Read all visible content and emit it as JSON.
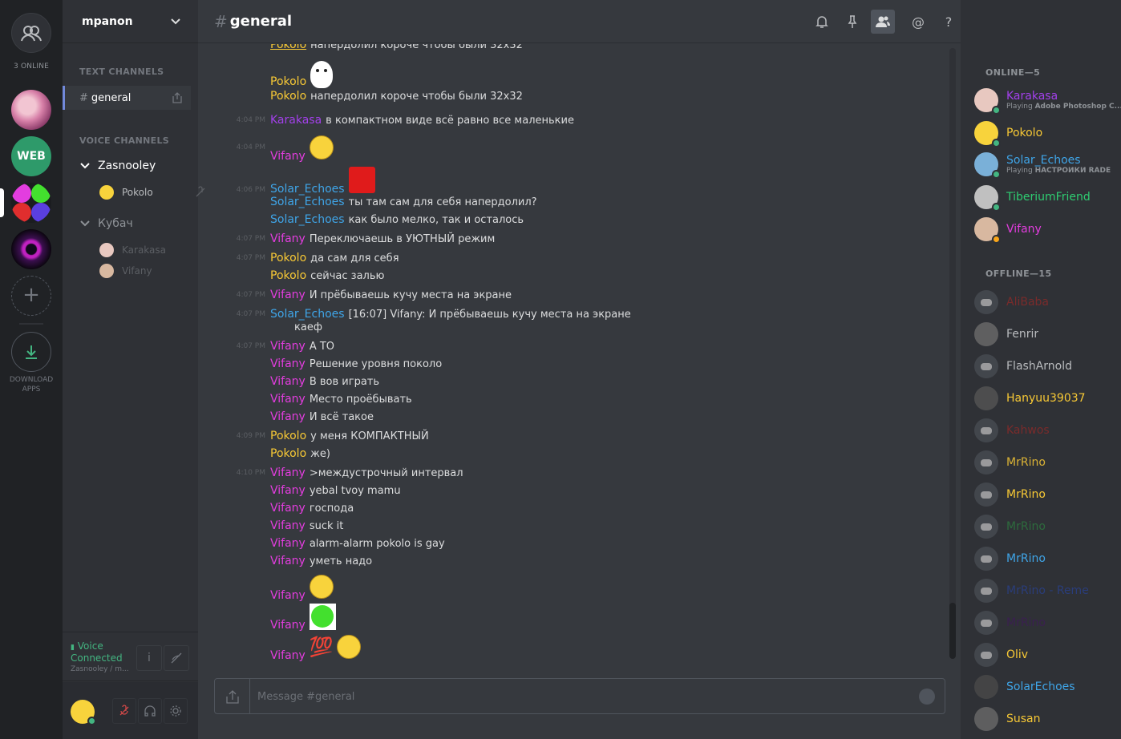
{
  "rail": {
    "online_count": "3 ONLINE",
    "web_server_label": "WEB",
    "add_server": "+",
    "download_label_1": "DOWNLOAD",
    "download_label_2": "APPS"
  },
  "guild": {
    "name": "mpanon",
    "text_category": "TEXT CHANNELS",
    "voice_category": "VOICE CHANNELS",
    "channel": "general",
    "voice_channels": [
      {
        "name": "Zasnooley",
        "users": [
          "Pokolo"
        ]
      },
      {
        "name": "Кубач",
        "users": [
          "Karakasa",
          "Vifany"
        ]
      }
    ]
  },
  "voice": {
    "status_1": "Voice",
    "status_2": "Connected",
    "sub": "Zasnooley / m..."
  },
  "header": {
    "hash": "#",
    "title": "general"
  },
  "messages": [
    {
      "time": "",
      "author": "Pokolo",
      "text": "напердолил короче чтобы были 32x32",
      "cut": true
    },
    {
      "time": "",
      "author": "Pokolo",
      "text": ""
    },
    {
      "time": "",
      "author": "Pokolo",
      "text": "напердолил короче чтобы были 32x32"
    },
    {
      "time": "4:04 PM",
      "author": "Karakasa",
      "text": "в компактном виде всё равно все маленькие"
    },
    {
      "time": "4:04 PM",
      "author": "Vifany",
      "text": ""
    },
    {
      "time": "4:06 PM",
      "author": "Solar_Echoes",
      "text": ""
    },
    {
      "time": "",
      "author": "Solar_Echoes",
      "text": "ты там сам для себя напердолил?"
    },
    {
      "time": "",
      "author": "Solar_Echoes",
      "text": "как было мелко, так и осталось"
    },
    {
      "time": "4:07 PM",
      "author": "Vifany",
      "text": "Переключаешь в УЮТНЫЙ режим"
    },
    {
      "time": "4:07 PM",
      "author": "Pokolo",
      "text": "да сам для себя"
    },
    {
      "time": "",
      "author": "Pokolo",
      "text": "сейчас залью"
    },
    {
      "time": "4:07 PM",
      "author": "Vifany",
      "text": "И прёбываешь кучу места на экране"
    },
    {
      "time": "4:07 PM",
      "author": "Solar_Echoes",
      "text": "[16:07] Vifany: И прёбываешь кучу места на экране",
      "text2": "каеф"
    },
    {
      "time": "4:07 PM",
      "author": "Vifany",
      "text": "А ТО"
    },
    {
      "time": "",
      "author": "Vifany",
      "text": "Решение уровня поколо"
    },
    {
      "time": "",
      "author": "Vifany",
      "text": "В вов играть"
    },
    {
      "time": "",
      "author": "Vifany",
      "text": "Место проёбывать"
    },
    {
      "time": "",
      "author": "Vifany",
      "text": "И всё такое"
    },
    {
      "time": "4:09 PM",
      "author": "Pokolo",
      "text": "у меня КОМПАКТНЫЙ"
    },
    {
      "time": "",
      "author": "Pokolo",
      "text": "же)"
    },
    {
      "time": "4:10 PM",
      "author": "Vifany",
      "text": ">междустрочный интервал"
    },
    {
      "time": "",
      "author": "Vifany",
      "text": "yebal tvoy mamu"
    },
    {
      "time": "",
      "author": "Vifany",
      "text": "господа"
    },
    {
      "time": "",
      "author": "Vifany",
      "text": "suck it"
    },
    {
      "time": "",
      "author": "Vifany",
      "text": "alarm-alarm pokolo is gay"
    },
    {
      "time": "",
      "author": "Vifany",
      "text": "уметь надо"
    },
    {
      "time": "",
      "author": "Vifany",
      "text": ""
    },
    {
      "time": "",
      "author": "Vifany",
      "text": ""
    },
    {
      "time": "",
      "author": "Vifany",
      "text": "💯"
    }
  ],
  "composer": {
    "placeholder": "Message #general"
  },
  "members": {
    "online_header": "ONLINE—5",
    "offline_header": "OFFLINE—15",
    "online": [
      {
        "name": "Karakasa",
        "activity_prefix": "Playing",
        "activity": "Adobe Photoshop C...",
        "color": "#a340eb",
        "status": "#43b581"
      },
      {
        "name": "Pokolo",
        "activity_prefix": "",
        "activity": "",
        "color": "#f8c935",
        "status": "#43b581"
      },
      {
        "name": "Solar_Echoes",
        "activity_prefix": "Playing",
        "activity": "НАСТРОЙКИ RADE",
        "color": "#3fa5e8",
        "status": "#43b581"
      },
      {
        "name": "TiberiumFriend",
        "activity_prefix": "",
        "activity": "",
        "color": "#2ecc71",
        "status": "#43b581"
      },
      {
        "name": "Vifany",
        "activity_prefix": "",
        "activity": "",
        "color": "#e33ddf",
        "status": "#faa61a"
      }
    ],
    "offline": [
      {
        "name": "AliBaba",
        "color": "#7a2b2b"
      },
      {
        "name": "Fenrir",
        "color": "#b9bbbe"
      },
      {
        "name": "FlashArnold",
        "color": "#b9bbbe"
      },
      {
        "name": "Hanyuu39037",
        "color": "#f8c935"
      },
      {
        "name": "Kahwos",
        "color": "#7a2b2b"
      },
      {
        "name": "MrRino",
        "color": "#f8c935"
      },
      {
        "name": "MrRino",
        "color": "#f8c935"
      },
      {
        "name": "MrRino",
        "color": "#2d6b3d"
      },
      {
        "name": "MrRino",
        "color": "#3fa5e8"
      },
      {
        "name": "MrRino - Reme",
        "color": "#2a3d7a"
      },
      {
        "name": "MrRino",
        "color": "#3a2050"
      },
      {
        "name": "Oliv",
        "color": "#f8c935"
      },
      {
        "name": "SolarEchoes",
        "color": "#3fa5e8"
      },
      {
        "name": "Susan",
        "color": "#f8c935"
      }
    ]
  }
}
